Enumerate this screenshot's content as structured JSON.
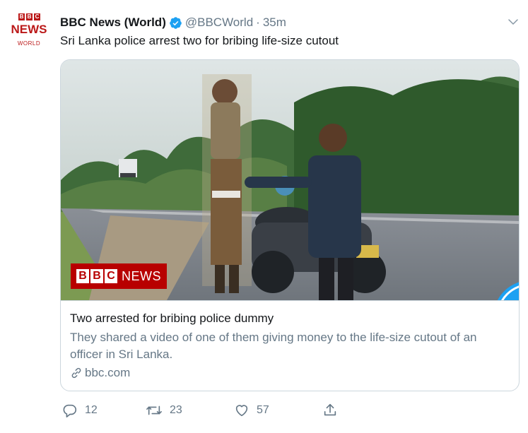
{
  "avatar": {
    "blocks": [
      "B",
      "B",
      "C"
    ],
    "news": "NEWS",
    "world": "WORLD"
  },
  "header": {
    "display_name": "BBC News (World)",
    "handle": "@BBCWorld",
    "separator": "·",
    "time": "35m"
  },
  "tweet": {
    "text": "Sri Lanka police arrest two for bribing life-size cutout"
  },
  "card": {
    "badge_blocks": [
      "B",
      "B",
      "C"
    ],
    "badge_word": "NEWS",
    "title": "Two arrested for bribing police dummy",
    "description": "They shared a video of one of them giving money to the life-size cutout of an officer in Sri Lanka.",
    "domain": "bbc.com"
  },
  "actions": {
    "reply_count": "12",
    "retweet_count": "23",
    "like_count": "57"
  },
  "colors": {
    "bbc_red": "#bb1919",
    "verified_blue": "#1da1f2",
    "secondary_text": "#657786",
    "border": "#ccd6dd"
  },
  "icons": [
    "verified-badge-icon",
    "chevron-down-icon",
    "link-icon",
    "reply-icon",
    "retweet-icon",
    "like-icon",
    "share-icon",
    "twitter-bird-icon"
  ]
}
